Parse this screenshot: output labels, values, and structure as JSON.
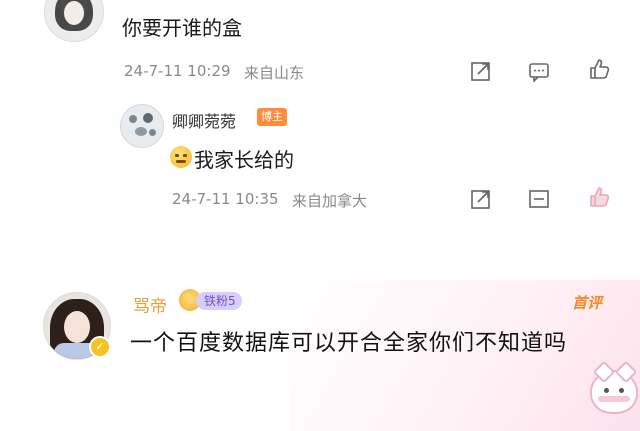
{
  "comment_top": {
    "text": "你要开谁的盒",
    "time": "24-7-11 10:29",
    "location": "来自山东"
  },
  "reply": {
    "username": "卿卿菀菀",
    "badge": "博主",
    "text": "我家长给的",
    "time": "24-7-11 10:35",
    "location": "来自加拿大"
  },
  "comment_bottom": {
    "username": "骂帝",
    "fan_badge": "铁粉5",
    "first_tag": "首评",
    "text": "一个百度数据库可以开合全家你们不知道吗"
  },
  "colors": {
    "meta_gray": "#8a8a8a",
    "boss_badge": "#ff8b3d",
    "name_gold": "#e3a03c",
    "first_tag": "#f08a2a",
    "fan_badge_bg": "#d9ccff"
  },
  "icons": {
    "share": "share-icon",
    "comment": "comment-icon",
    "like": "thumbs-up-icon"
  }
}
